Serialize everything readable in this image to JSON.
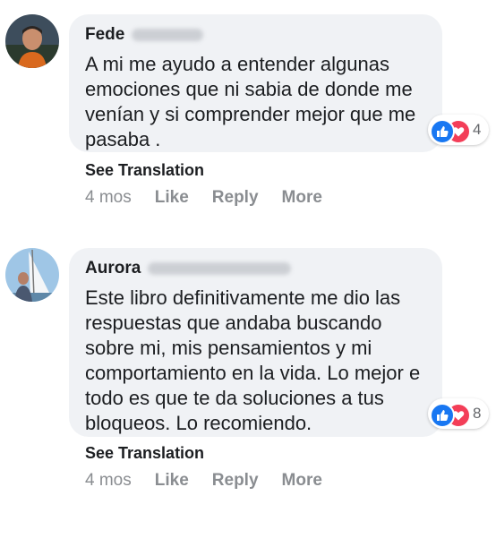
{
  "comments": [
    {
      "author": "Fede",
      "text": "A mi me ayudo a entender algunas emociones que ni sabia de donde me venían y si comprender mejor que me pasaba .",
      "reaction_count": "4",
      "see_translation": "See Translation",
      "time": "4 mos",
      "like_label": "Like",
      "reply_label": "Reply",
      "more_label": "More"
    },
    {
      "author": "Aurora",
      "text": "Este libro definitivamente me dio las respuestas que andaba buscando sobre mi, mis pensamientos y mi comportamiento en la vida. Lo mejor e todo es que te da soluciones a tus bloqueos. Lo recomiendo.",
      "reaction_count": "8",
      "see_translation": "See Translation",
      "time": "4 mos",
      "like_label": "Like",
      "reply_label": "Reply",
      "more_label": "More"
    }
  ],
  "colors": {
    "bubble": "#f0f2f5",
    "like_blue": "#1877f2",
    "love_red": "#f33e58",
    "muted": "#8a8d91"
  },
  "icons": [
    "avatar-fede",
    "avatar-aurora",
    "like-reaction-icon",
    "love-reaction-icon"
  ]
}
